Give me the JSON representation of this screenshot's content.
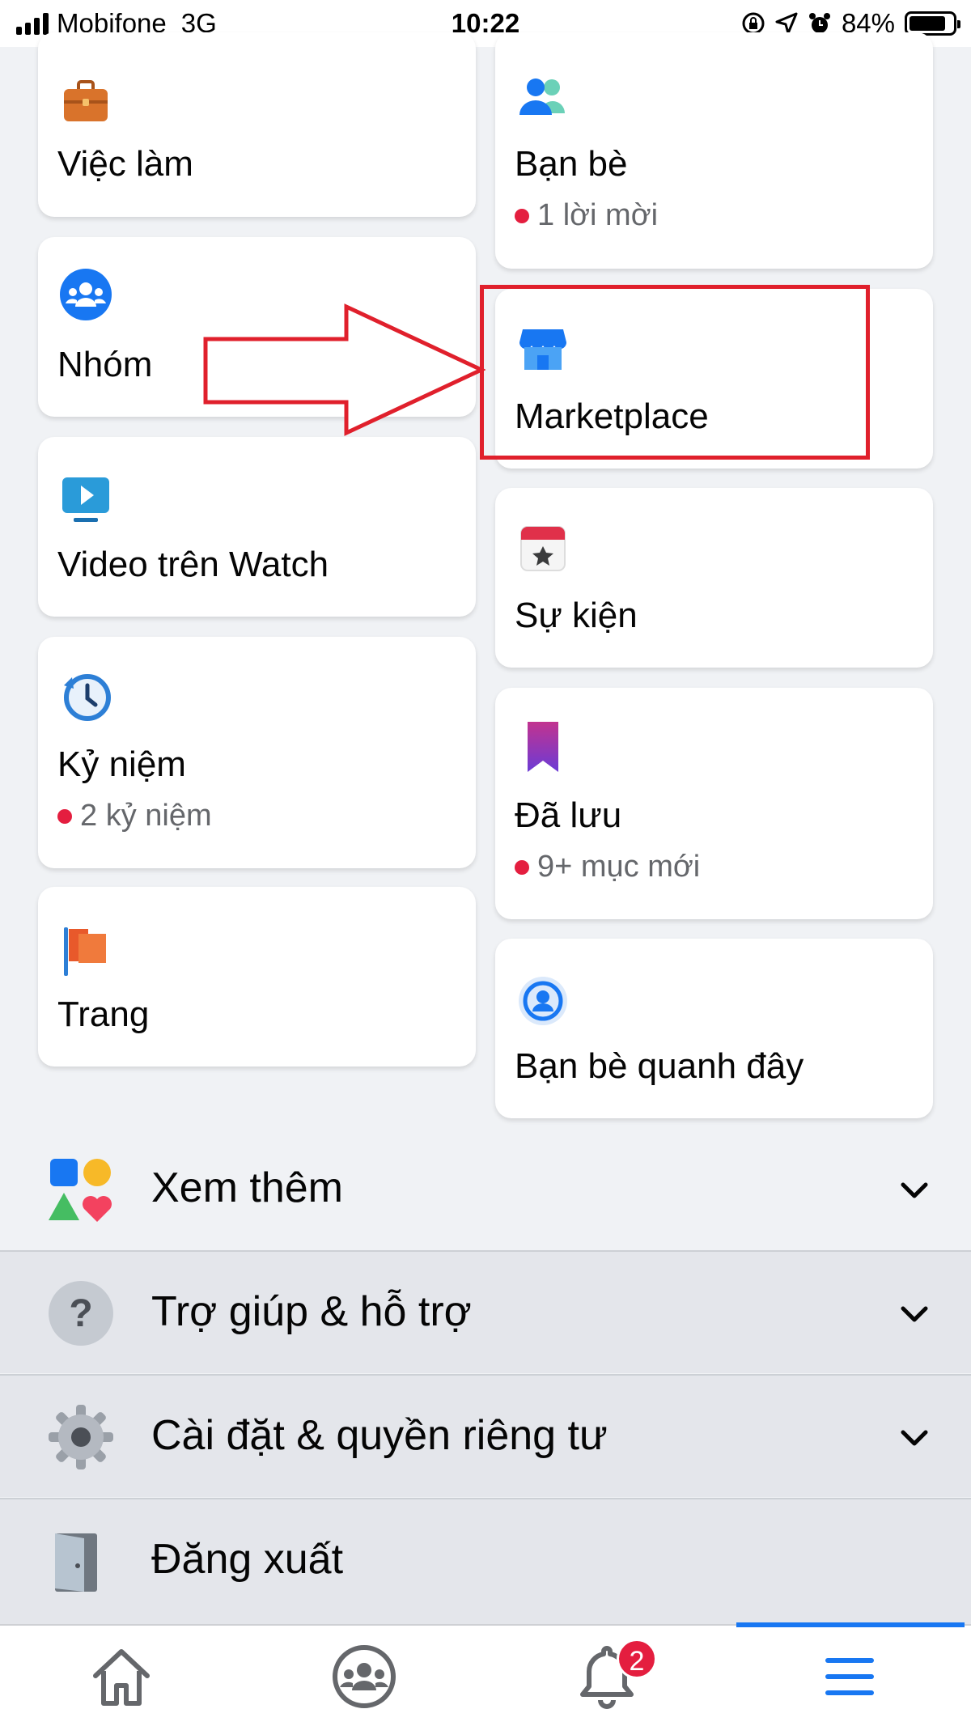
{
  "status_bar": {
    "carrier": "Mobifone",
    "network": "3G",
    "time": "10:22",
    "battery": "84%",
    "battery_fraction": 0.84
  },
  "shortcuts": {
    "left": [
      {
        "title": "Việc làm",
        "icon": "briefcase-icon"
      },
      {
        "title": "Nhóm",
        "icon": "groups-icon"
      },
      {
        "title": "Video trên Watch",
        "icon": "watch-video-icon"
      },
      {
        "title": "Kỷ niệm",
        "sub": "2 kỷ niệm",
        "icon": "memories-clock-icon"
      },
      {
        "title": "Trang",
        "icon": "pages-flag-icon"
      }
    ],
    "right": [
      {
        "title": "Bạn bè",
        "sub": "1 lời mời",
        "icon": "friends-icon"
      },
      {
        "title": "Marketplace",
        "icon": "marketplace-shop-icon"
      },
      {
        "title": "Sự kiện",
        "icon": "events-calendar-icon"
      },
      {
        "title": "Đã lưu",
        "sub": "9+ mục mới",
        "icon": "saved-bookmark-icon"
      },
      {
        "title": "Bạn bè quanh đây",
        "icon": "nearby-friends-icon"
      }
    ]
  },
  "menu_rows": [
    {
      "label": "Xem thêm",
      "icon": "see-more-shapes-icon"
    },
    {
      "label": "Trợ giúp & hỗ trợ",
      "icon": "help-question-icon"
    },
    {
      "label": "Cài đặt & quyền riêng tư",
      "icon": "settings-gear-icon"
    },
    {
      "label": "Đăng xuất",
      "icon": "logout-door-icon"
    }
  ],
  "bottom_nav": {
    "notification_badge": "2",
    "items": [
      "home-icon",
      "groups-icon",
      "notifications-bell-icon",
      "menu-hamburger-icon"
    ],
    "active": "menu-hamburger-icon"
  },
  "colors": {
    "background": "#f0f2f5",
    "accent": "#1877f2",
    "badge": "#e41e3f",
    "highlight": "#e0202c"
  }
}
